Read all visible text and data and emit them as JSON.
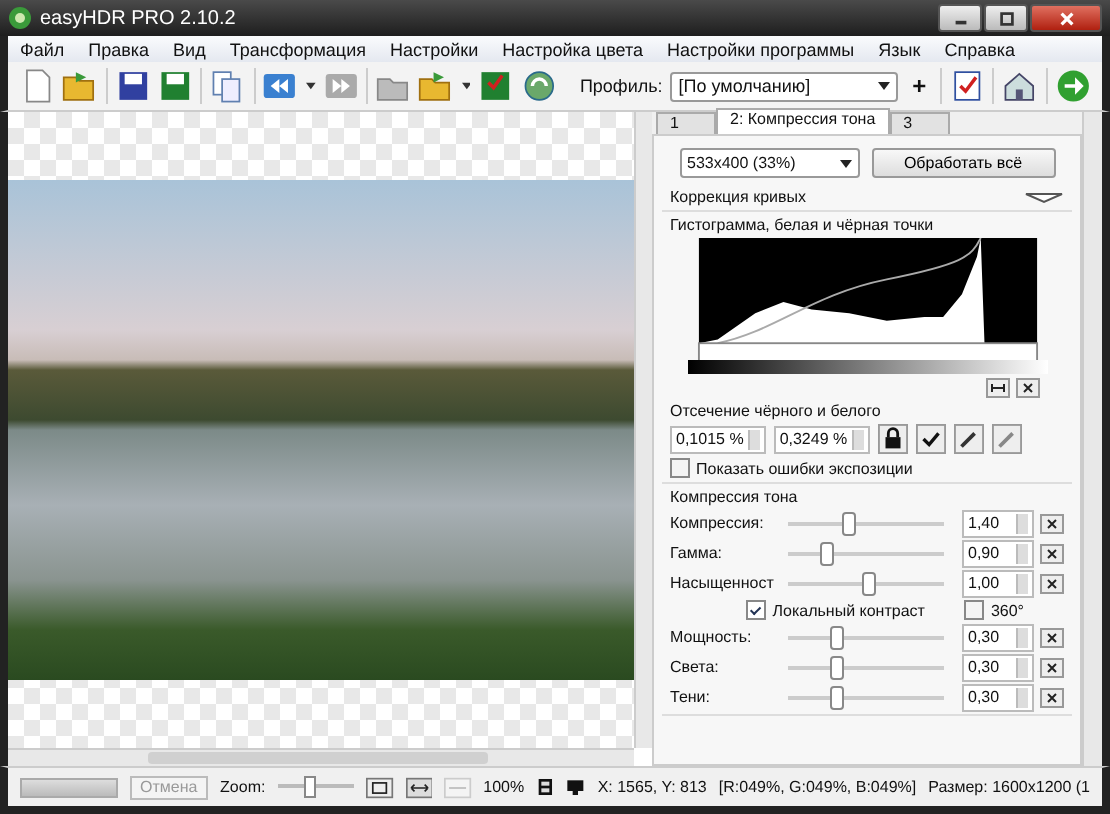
{
  "window": {
    "title": "easyHDR PRO 2.10.2"
  },
  "menu": [
    "Файл",
    "Правка",
    "Вид",
    "Трансформация",
    "Настройки",
    "Настройка цвета",
    "Настройки программы",
    "Язык",
    "Справка"
  ],
  "toolbar": {
    "profile_label": "Профиль:",
    "profile_value": "[По умолчанию]",
    "add": "+"
  },
  "tabs": [
    {
      "label": "1",
      "selected": false
    },
    {
      "label": "2: Компрессия тона",
      "selected": true
    },
    {
      "label": "3",
      "selected": false
    }
  ],
  "preview_size": "533x400 (33%)",
  "process_button": "Обработать всё",
  "curves_section": "Коррекция кривых",
  "histogram_title": "Гистограмма, белая и чёрная точки",
  "clipping": {
    "label": "Отсечение чёрного и белого",
    "black": "0,1015 %",
    "white": "0,3249 %"
  },
  "show_errors": {
    "label": "Показать ошибки экспозиции",
    "checked": false
  },
  "tone_section": "Компрессия тона",
  "sliders": [
    {
      "label": "Компрессия:",
      "level": 0.37,
      "value": "1,40"
    },
    {
      "label": "Гамма:",
      "level": 0.23,
      "value": "0,90"
    },
    {
      "label": "Насыщенност",
      "level": 0.5,
      "value": "1,00"
    }
  ],
  "local_contrast": {
    "label": "Локальный контраст",
    "checked": true
  },
  "deg360": {
    "label": "360°",
    "checked": false
  },
  "sliders2": [
    {
      "label": "Мощность:",
      "level": 0.3,
      "value": "0,30"
    },
    {
      "label": "Света:",
      "level": 0.3,
      "value": "0,30"
    },
    {
      "label": "Тени:",
      "level": 0.3,
      "value": "0,30"
    }
  ],
  "status": {
    "cancel": "Отмена",
    "zoom_label": "Zoom:",
    "zoom": {
      "level": 0.4
    },
    "zoom_percent": "100%",
    "coords": "X: 1565, Y: 813",
    "rgb": "[R:049%, G:049%, B:049%]",
    "size": "Размер: 1600x1200 (1"
  }
}
